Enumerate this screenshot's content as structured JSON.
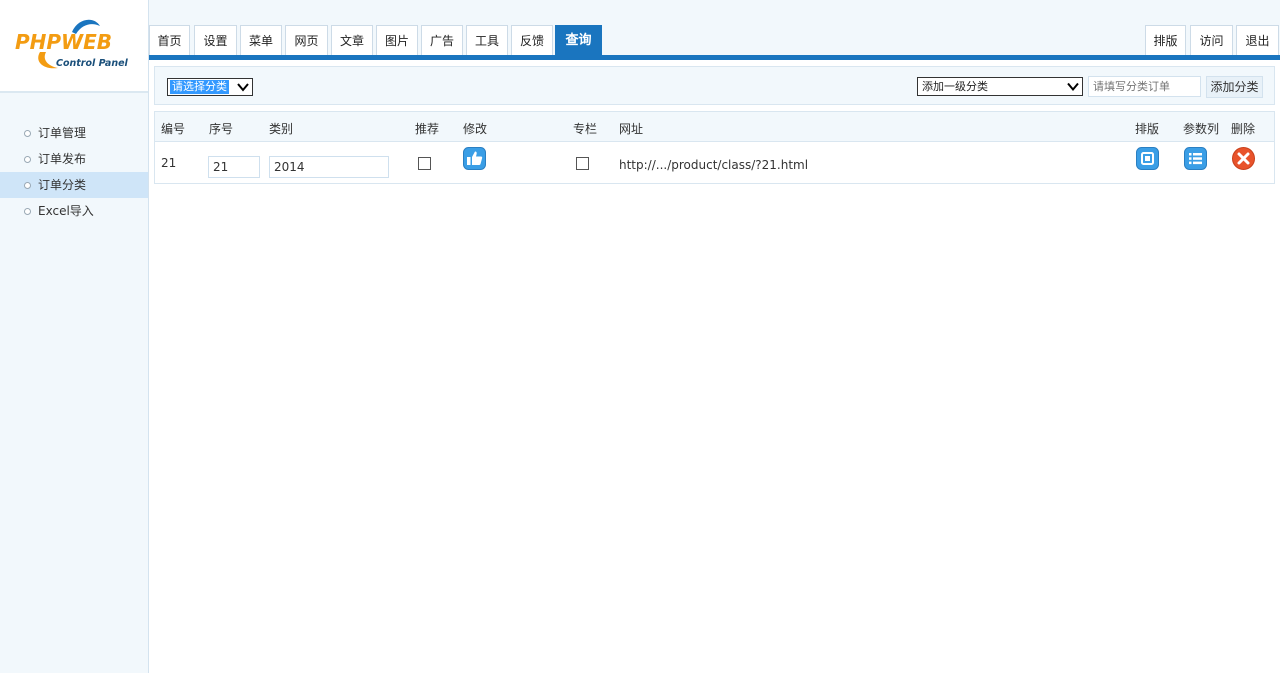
{
  "logo": {
    "brand": "PHPWEB",
    "tagline": "Control Panel"
  },
  "sidebar": {
    "items": [
      {
        "label": "订单管理"
      },
      {
        "label": "订单发布"
      },
      {
        "label": "订单分类",
        "active": true
      },
      {
        "label": "Excel导入"
      }
    ]
  },
  "nav": {
    "tabs": [
      {
        "label": "首页"
      },
      {
        "label": "设置"
      },
      {
        "label": "菜单"
      },
      {
        "label": "网页"
      },
      {
        "label": "文章"
      },
      {
        "label": "图片"
      },
      {
        "label": "广告"
      },
      {
        "label": "工具"
      },
      {
        "label": "反馈"
      },
      {
        "label": "查询",
        "active": true
      }
    ],
    "right_tabs": [
      {
        "label": "排版"
      },
      {
        "label": "访问"
      },
      {
        "label": "退出"
      }
    ]
  },
  "filter": {
    "category_select": "请选择分类",
    "level_select": "添加一级分类",
    "new_category_placeholder": "请填写分类订单",
    "add_button": "添加分类"
  },
  "table": {
    "columns": [
      "编号",
      "序号",
      "类别",
      "推荐",
      "修改",
      "专栏",
      "网址",
      "排版",
      "参数列",
      "删除"
    ],
    "rows": [
      {
        "id": "21",
        "order": "21",
        "category": "2014",
        "recommended": false,
        "featured": false,
        "url": "http://.../product/class/?21.html"
      }
    ]
  },
  "colors": {
    "accent": "#1a75bf",
    "sidebar_bg": "#f2f8fc",
    "active_item": "#cfe5f8",
    "delete": "#e8532b",
    "icon_blue": "#3a9ee6"
  },
  "icons": [
    "thumbs-up-icon",
    "layout-icon",
    "list-icon",
    "delete-icon",
    "chevron-down-icon"
  ]
}
